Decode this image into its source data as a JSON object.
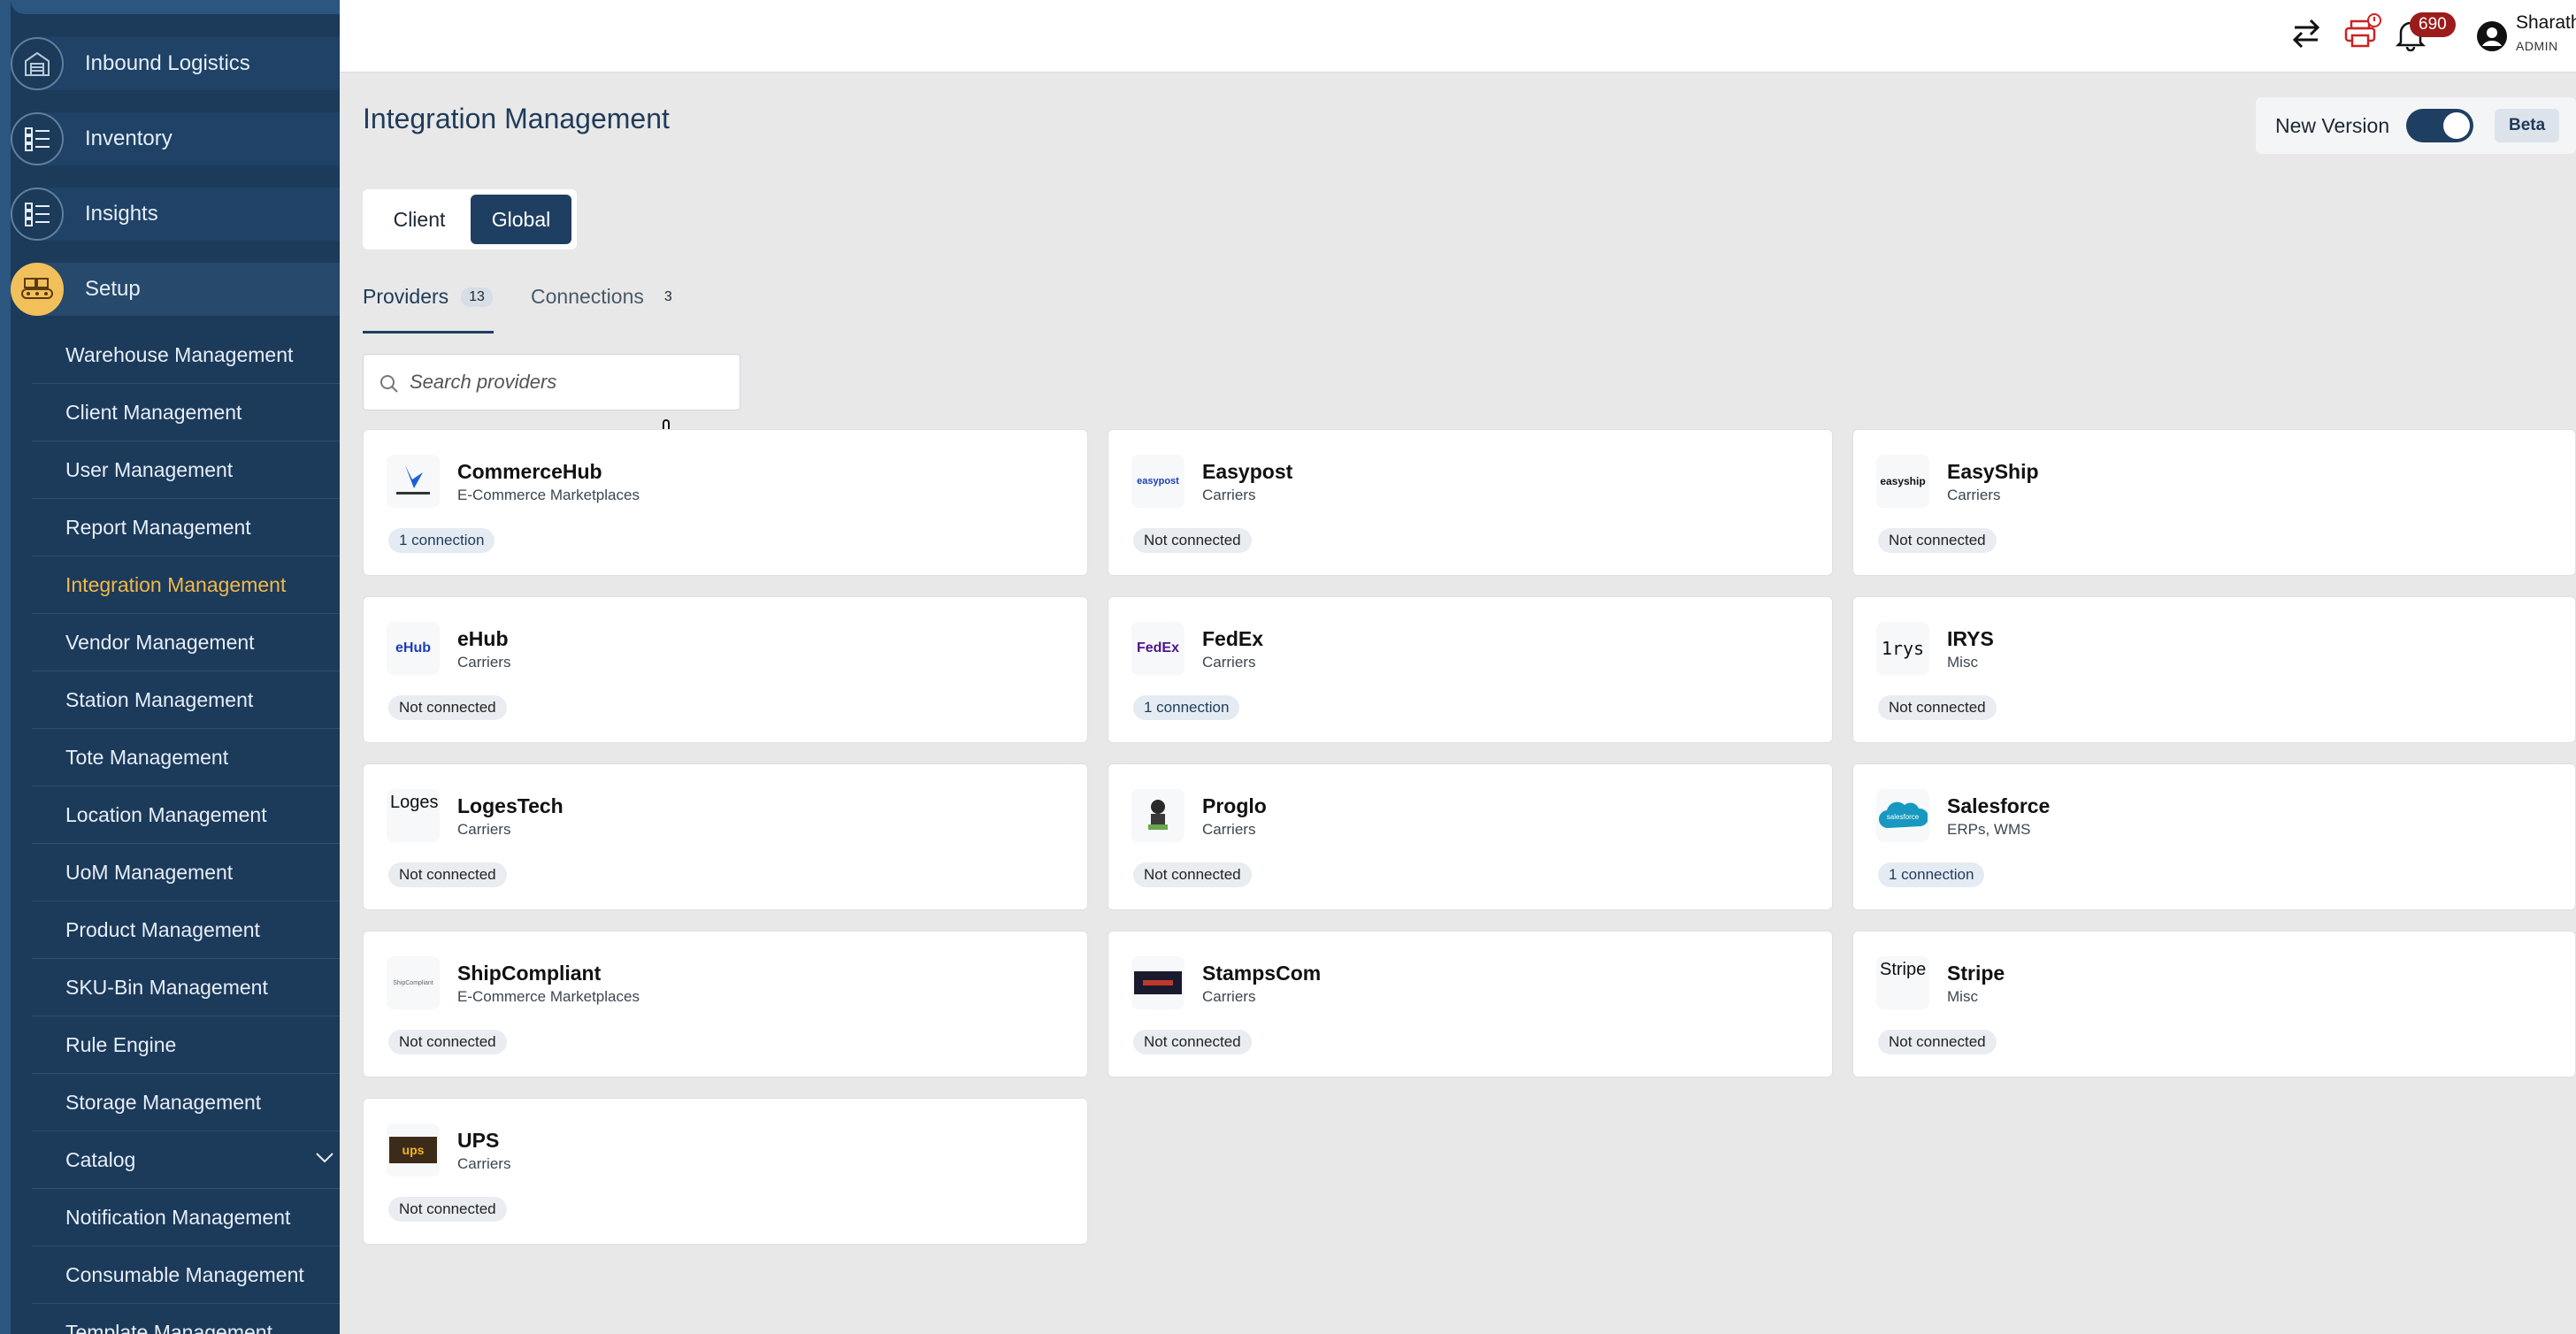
{
  "sidebar": {
    "main_items": [
      {
        "label": "Inbound Logistics",
        "icon": "warehouse-icon"
      },
      {
        "label": "Inventory",
        "icon": "checklist-icon"
      },
      {
        "label": "Insights",
        "icon": "checklist-icon"
      },
      {
        "label": "Setup",
        "icon": "conveyor-icon"
      }
    ],
    "setup_items": [
      "Warehouse Management",
      "Client Management",
      "User Management",
      "Report Management",
      "Integration Management",
      "Vendor Management",
      "Station Management",
      "Tote Management",
      "Location Management",
      "UoM Management",
      "Product Management",
      "SKU-Bin Management",
      "Rule Engine",
      "Storage Management",
      "Catalog",
      "Notification Management",
      "Consumable Management",
      "Template Management"
    ],
    "active_item": "Integration Management"
  },
  "topbar": {
    "notification_count": "690",
    "user_name": "Sharath",
    "user_role": "ADMIN"
  },
  "page": {
    "title": "Integration Management",
    "new_version_label": "New Version",
    "new_version_enabled": true,
    "beta_label": "Beta",
    "scope": {
      "client": "Client",
      "global": "Global",
      "selected": "Global"
    },
    "tabs": [
      {
        "label": "Providers",
        "count": "13"
      },
      {
        "label": "Connections",
        "count": "3"
      }
    ],
    "search_placeholder": "Search providers"
  },
  "providers": [
    {
      "name": "CommerceHub",
      "category": "E-Commerce Marketplaces",
      "status": "1 connection",
      "logo_text": "CommerceHub"
    },
    {
      "name": "Easypost",
      "category": "Carriers",
      "status": "Not connected",
      "logo_text": "easypost"
    },
    {
      "name": "EasyShip",
      "category": "Carriers",
      "status": "Not connected",
      "logo_text": "easyship"
    },
    {
      "name": "eHub",
      "category": "Carriers",
      "status": "Not connected",
      "logo_text": "eHub"
    },
    {
      "name": "FedEx",
      "category": "Carriers",
      "status": "1 connection",
      "logo_text": "FedEx"
    },
    {
      "name": "IRYS",
      "category": "Misc",
      "status": "Not connected",
      "logo_text": "1rys"
    },
    {
      "name": "LogesTech",
      "category": "Carriers",
      "status": "Not connected",
      "logo_text": "Loges"
    },
    {
      "name": "Proglo",
      "category": "Carriers",
      "status": "Not connected",
      "logo_text": ""
    },
    {
      "name": "Salesforce",
      "category": "ERPs, WMS",
      "status": "1 connection",
      "logo_text": "salesforce"
    },
    {
      "name": "ShipCompliant",
      "category": "E-Commerce Marketplaces",
      "status": "Not connected",
      "logo_text": "ShipCompliant"
    },
    {
      "name": "StampsCom",
      "category": "Carriers",
      "status": "Not connected",
      "logo_text": ""
    },
    {
      "name": "Stripe",
      "category": "Misc",
      "status": "Not connected",
      "logo_text": "Stripe"
    },
    {
      "name": "UPS",
      "category": "Carriers",
      "status": "Not connected",
      "logo_text": "ups"
    }
  ],
  "colors": {
    "sidebar": "#1c3a5a",
    "accent": "#1f3f62",
    "active_nav": "#f0b84b",
    "badge": "#9c1b1b"
  }
}
